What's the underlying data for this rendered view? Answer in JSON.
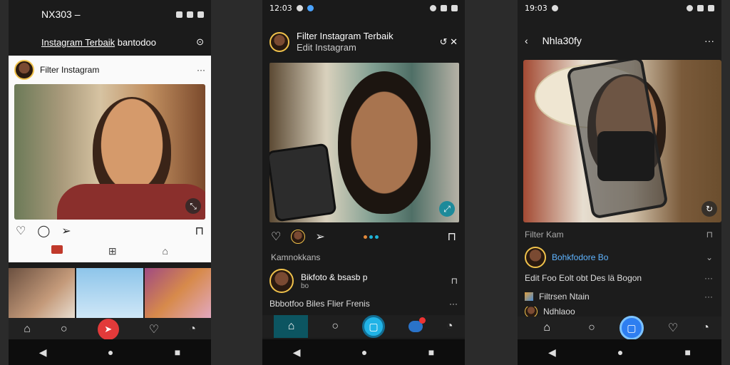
{
  "phone1": {
    "status_time": "NX303 –",
    "header_title": "Instagram Terbaik",
    "header_sub": "bantodoo",
    "post_user": "Filter Instagram",
    "more": "···"
  },
  "phone2": {
    "status_time": "12:03",
    "header_title": "Filter Instagram Terbaik",
    "header_sub": "Edit Instagram",
    "section_label": "Kamnokkans",
    "row1_title": "Bikfoto & bsasb p",
    "row1_sub": "bo",
    "row2_text": "Bbbotfoo Biles Flier Frenis",
    "more": "···"
  },
  "phone3": {
    "status_time": "19:03",
    "header_title": "Nhla30fy",
    "more": "···",
    "section_label": "Filter Kam",
    "row1_name": "Bohkfodore Bo",
    "row2_text": "Edit Foo Eolt obt Des lä Bogon",
    "row3_text": "Filtrsen Ntain",
    "row4_text": "Ndhlaoo",
    "accent_blue": "#21b3e6"
  }
}
